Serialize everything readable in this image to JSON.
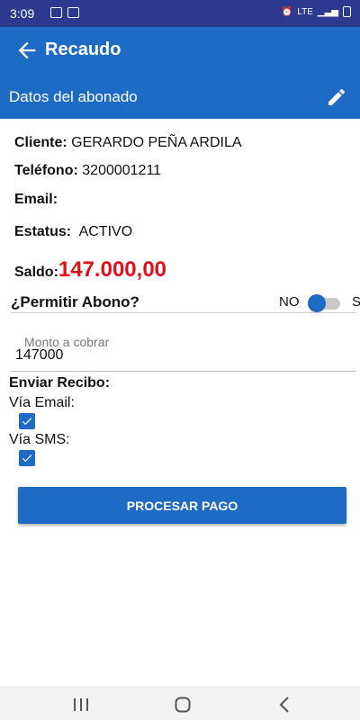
{
  "status_bar": {
    "time": "3:09",
    "network": "LTE"
  },
  "app_bar": {
    "title": "Recaudo"
  },
  "section": {
    "title": "Datos del abonado"
  },
  "subscriber": {
    "cliente_label": "Cliente:",
    "cliente_value": "GERARDO PEÑA ARDILA",
    "telefono_label": "Teléfono:",
    "telefono_value": "3200001211",
    "email_label": "Email:",
    "email_value": "",
    "estatus_label": "Estatus:",
    "estatus_value": "ACTIVO",
    "saldo_label": "Saldo:",
    "saldo_value": "147.000,00"
  },
  "permitir_abono": {
    "label": "¿Permitir Abono?",
    "no_label": "NO",
    "si_label": "SI"
  },
  "monto": {
    "placeholder": "Monto a cobrar",
    "value": "147000"
  },
  "recibo": {
    "label": "Enviar Recibo:",
    "email_label": "Vía Email:",
    "sms_label": "Vía SMS:"
  },
  "buttons": {
    "procesar": "PROCESAR PAGO"
  },
  "colors": {
    "primary": "#1d6bc5",
    "status_bar": "#2b3a8f",
    "saldo": "#e3101c"
  }
}
